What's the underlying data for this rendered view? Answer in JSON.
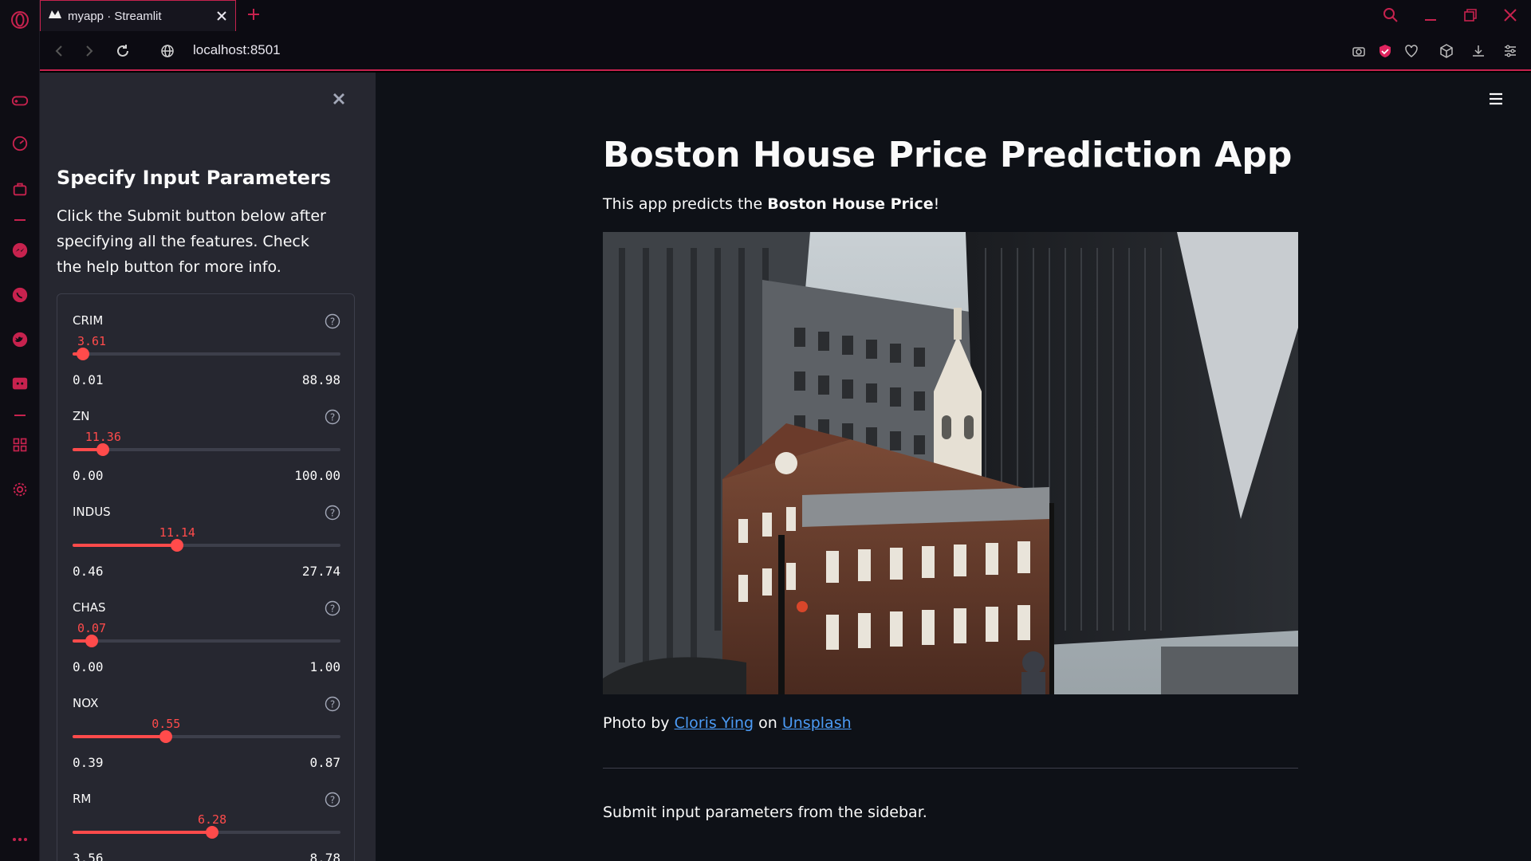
{
  "browser": {
    "tab_title": "myapp · Streamlit",
    "url": "localhost:8501"
  },
  "sidebar": {
    "title": "Specify Input Parameters",
    "description": "Click the Submit button below after specifying all the features. Check the help button for more info.",
    "sliders": [
      {
        "label": "CRIM",
        "value": "3.61",
        "min": "0.01",
        "max": "88.98",
        "fraction": 0.04
      },
      {
        "label": "ZN",
        "value": "11.36",
        "min": "0.00",
        "max": "100.00",
        "fraction": 0.114
      },
      {
        "label": "INDUS",
        "value": "11.14",
        "min": "0.46",
        "max": "27.74",
        "fraction": 0.391
      },
      {
        "label": "CHAS",
        "value": "0.07",
        "min": "0.00",
        "max": "1.00",
        "fraction": 0.07
      },
      {
        "label": "NOX",
        "value": "0.55",
        "min": "0.39",
        "max": "0.87",
        "fraction": 0.349
      },
      {
        "label": "RM",
        "value": "6.28",
        "min": "3.56",
        "max": "8.78",
        "fraction": 0.521
      }
    ]
  },
  "main": {
    "title": "Boston House Price Prediction App",
    "subtitle_prefix": "This app predicts the ",
    "subtitle_bold": "Boston House Price",
    "subtitle_suffix": "!",
    "credit_prefix": "Photo by ",
    "credit_author": "Cloris Ying",
    "credit_middle": " on ",
    "credit_site": "Unsplash",
    "status": "Submit input parameters from the sidebar."
  },
  "colors": {
    "accent": "#ff4b4b",
    "opera_red": "#c7224e",
    "sidebar_bg": "#262730",
    "main_bg": "#0e1117",
    "link": "#4c9bf5"
  }
}
